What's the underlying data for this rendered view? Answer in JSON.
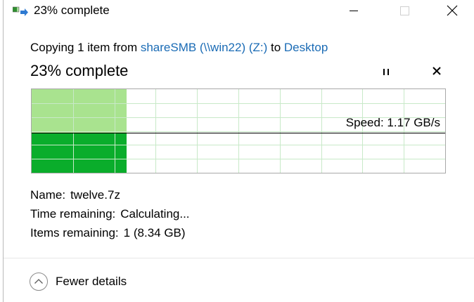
{
  "window": {
    "title": "23% complete",
    "minimize_icon": "minimize-icon",
    "maximize_icon": "maximize-icon",
    "close_icon": "close-icon"
  },
  "copy": {
    "prefix": "Copying 1 item from ",
    "source": "shareSMB (\\\\win22) (Z:)",
    "middle": " to ",
    "destination": "Desktop"
  },
  "status": {
    "text": "23% complete",
    "progress_fraction": 0.23
  },
  "graph": {
    "speed_text": "Speed: 1.17 GB/s",
    "colors": {
      "fill_dark": "#0aad2b",
      "fill_light": "#a9e38f",
      "grid": "#c8e9c8",
      "speed_line": "#000000"
    }
  },
  "details": {
    "name_label": "Name:",
    "name_value": "twelve.7z",
    "time_label": "Time remaining:",
    "time_value": "Calculating...",
    "items_label": "Items remaining:",
    "items_value": "1 (8.34 GB)"
  },
  "footer": {
    "toggle_label": "Fewer details",
    "toggle_icon": "chevron-up-icon"
  },
  "colors": {
    "link": "#1a6bb5"
  }
}
